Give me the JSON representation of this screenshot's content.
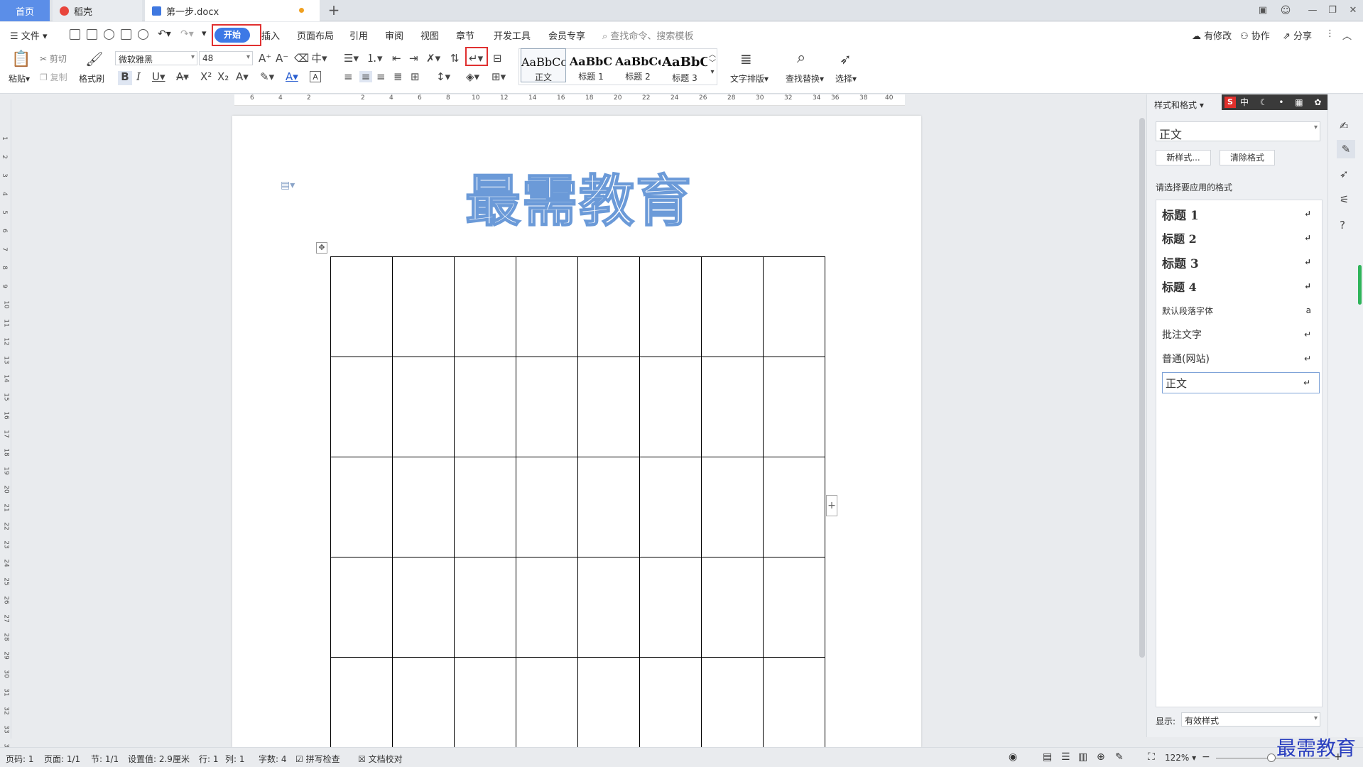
{
  "titlebar": {
    "tabs": [
      {
        "label": "首页"
      },
      {
        "label": "稻壳"
      },
      {
        "label": "第一步.docx"
      }
    ],
    "add_tab": "+",
    "window": {
      "minimize": "—",
      "restore": "❐",
      "close": "✕"
    }
  },
  "menu": {
    "file": "文件",
    "items": [
      "开始",
      "插入",
      "页面布局",
      "引用",
      "审阅",
      "视图",
      "章节",
      "开发工具",
      "会员专享"
    ],
    "search_placeholder": "查找命令、搜索模板",
    "right": {
      "modified": "有修改",
      "collab": "协作",
      "share": "分享"
    }
  },
  "ribbon": {
    "paste": "粘贴",
    "cut": "剪切",
    "copy": "复制",
    "format_painter": "格式刷",
    "font_name": "微软雅黑",
    "font_size": "48",
    "styles": [
      {
        "preview": "AaBbCcI",
        "name": "正文"
      },
      {
        "preview": "AaBbC",
        "name": "标题 1"
      },
      {
        "preview": "AaBbCc",
        "name": "标题 2"
      },
      {
        "preview": "AaBbC",
        "name": "标题 3"
      }
    ],
    "text_layout": "文字排版",
    "find_replace": "查找替换",
    "select": "选择"
  },
  "ruler": {
    "h_ticks": [
      "6",
      "4",
      "2",
      "2",
      "4",
      "6",
      "8",
      "10",
      "12",
      "14",
      "16",
      "18",
      "20",
      "22",
      "24",
      "26",
      "28",
      "30",
      "32",
      "34",
      "36",
      "38",
      "40"
    ],
    "v_ticks": [
      "1",
      "2",
      "3",
      "4",
      "5",
      "6",
      "7",
      "8",
      "9",
      "10",
      "11",
      "12",
      "13",
      "14",
      "15",
      "16",
      "17",
      "18",
      "19",
      "20",
      "21",
      "22",
      "23",
      "24",
      "25",
      "26",
      "27",
      "28",
      "29",
      "30",
      "31",
      "32",
      "33",
      "34"
    ]
  },
  "document": {
    "heading": "最需教育",
    "table": {
      "rows": 5,
      "cols": 8
    }
  },
  "style_panel": {
    "title": "样式和格式",
    "current": "正文",
    "new_style": "新样式...",
    "clear_format": "清除格式",
    "prompt": "请选择要应用的格式",
    "items": [
      "标题 1",
      "标题 2",
      "标题 3",
      "标题 4",
      "默认段落字体",
      "批注文字",
      "普通(网站)",
      "正文"
    ],
    "show_label": "显示:",
    "show_value": "有效样式"
  },
  "statusbar": {
    "page_num": "页码: 1",
    "pages": "页面: 1/1",
    "section": "节: 1/1",
    "setting": "设置值: 2.9厘米",
    "row": "行: 1",
    "col": "列: 1",
    "words": "字数: 4",
    "spell": "拼写检查",
    "proof": "文档校对",
    "zoom": "122%"
  },
  "watermark": "最需教育",
  "colors": {
    "accent": "#3d79e6",
    "highlight": "#e03030",
    "heading_outline": "#6b9ad8"
  }
}
